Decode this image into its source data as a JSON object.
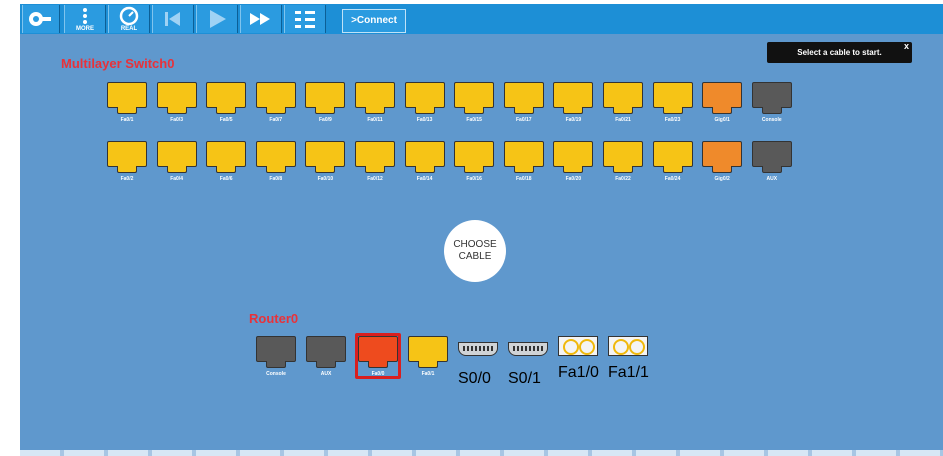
{
  "toolbar": {
    "buttons": [
      {
        "label": "",
        "icon": "settings-icon"
      },
      {
        "label": "MORE",
        "icon": "more-icon"
      },
      {
        "label": "REAL",
        "icon": "real-time-icon"
      },
      {
        "label": "",
        "icon": "previous-icon"
      },
      {
        "label": "",
        "icon": "play-icon"
      },
      {
        "label": "",
        "icon": "fast-forward-icon"
      },
      {
        "label": "",
        "icon": "list-icon"
      }
    ],
    "connect_label": ">Connect"
  },
  "hint": {
    "text": "Select a cable to start.",
    "close": "x"
  },
  "switch": {
    "title": "Multilayer Switch0",
    "row1": [
      {
        "label": "Fa0/1",
        "color": "yellow"
      },
      {
        "label": "Fa0/3",
        "color": "yellow"
      },
      {
        "label": "Fa0/5",
        "color": "yellow"
      },
      {
        "label": "Fa0/7",
        "color": "yellow"
      },
      {
        "label": "Fa0/9",
        "color": "yellow"
      },
      {
        "label": "Fa0/11",
        "color": "yellow"
      },
      {
        "label": "Fa0/13",
        "color": "yellow"
      },
      {
        "label": "Fa0/15",
        "color": "yellow"
      },
      {
        "label": "Fa0/17",
        "color": "yellow"
      },
      {
        "label": "Fa0/19",
        "color": "yellow"
      },
      {
        "label": "Fa0/21",
        "color": "yellow"
      },
      {
        "label": "Fa0/23",
        "color": "yellow"
      },
      {
        "label": "Gig0/1",
        "color": "orange"
      },
      {
        "label": "Console",
        "color": "gray"
      }
    ],
    "row2": [
      {
        "label": "Fa0/2",
        "color": "yellow"
      },
      {
        "label": "Fa0/4",
        "color": "yellow"
      },
      {
        "label": "Fa0/6",
        "color": "yellow"
      },
      {
        "label": "Fa0/8",
        "color": "yellow"
      },
      {
        "label": "Fa0/10",
        "color": "yellow"
      },
      {
        "label": "Fa0/12",
        "color": "yellow"
      },
      {
        "label": "Fa0/14",
        "color": "yellow"
      },
      {
        "label": "Fa0/16",
        "color": "yellow"
      },
      {
        "label": "Fa0/18",
        "color": "yellow"
      },
      {
        "label": "Fa0/20",
        "color": "yellow"
      },
      {
        "label": "Fa0/22",
        "color": "yellow"
      },
      {
        "label": "Fa0/24",
        "color": "yellow"
      },
      {
        "label": "Gig0/2",
        "color": "orange"
      },
      {
        "label": "AUX",
        "color": "gray"
      }
    ]
  },
  "choose_cable": {
    "line1": "CHOOSE",
    "line2": "CABLE"
  },
  "router": {
    "title": "Router0",
    "ports": [
      {
        "label": "Console",
        "kind": "rj45",
        "color": "gray"
      },
      {
        "label": "AUX",
        "kind": "rj45",
        "color": "gray"
      },
      {
        "label": "Fa0/0",
        "kind": "rj45",
        "color": "red",
        "selected": true
      },
      {
        "label": "Fa0/1",
        "kind": "rj45",
        "color": "yellow"
      },
      {
        "label": "S0/0",
        "kind": "serial"
      },
      {
        "label": "S0/1",
        "kind": "serial"
      },
      {
        "label": "Fa1/0",
        "kind": "fiber"
      },
      {
        "label": "Fa1/1",
        "kind": "fiber"
      }
    ]
  },
  "colors": {
    "toolbar": "#1d8fd6",
    "stage": "#5f98cd",
    "port_yellow": "#f6c416",
    "port_orange": "#ef8a2b",
    "port_gray": "#595959",
    "port_selected": "#ee4b1e",
    "title_red": "#e8323a"
  }
}
